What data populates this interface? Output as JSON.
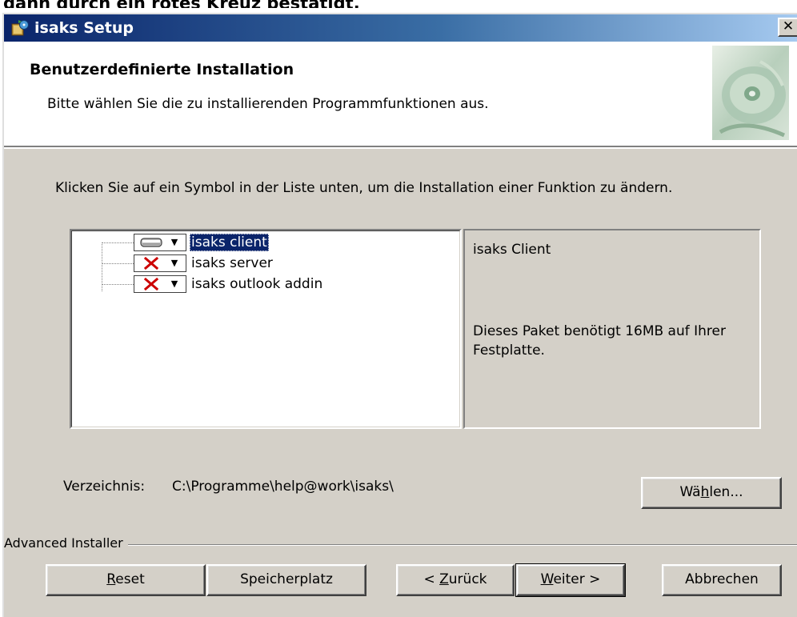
{
  "top_caption": "dann durch ein rotes Kreuz bestätigt.",
  "window": {
    "title": "isaks Setup",
    "close_symbol": "✕",
    "icon": "setup-package-icon"
  },
  "header": {
    "title": "Benutzerdefinierte Installation",
    "subtitle": "Bitte wählen Sie die zu installierenden Programmfunktionen aus.",
    "graphic": "cd-disc-graphic"
  },
  "instruction": "Klicken Sie auf ein Symbol in der Liste unten, um die Installation einer Funktion zu ändern.",
  "features": [
    {
      "label": "isaks client",
      "state": "install-local",
      "icon": "hard-drive-icon",
      "selected": true
    },
    {
      "label": "isaks server",
      "state": "not-installed",
      "icon": "red-x-icon",
      "selected": false
    },
    {
      "label": "isaks outlook addin",
      "state": "not-installed",
      "icon": "red-x-icon",
      "selected": false
    }
  ],
  "info": {
    "name": "isaks Client",
    "description": "Dieses Paket benötigt 16MB auf Ihrer Festplatte."
  },
  "directory": {
    "label": "Verzeichnis:",
    "value": "C:\\Programme\\help@work\\isaks\\"
  },
  "buttons": {
    "browse": {
      "pre": "Wä",
      "key": "h",
      "post": "len..."
    },
    "reset": {
      "pre": "",
      "key": "R",
      "post": "eset"
    },
    "disk_cost": "Speicherplatz",
    "back": {
      "pre": "< ",
      "key": "Z",
      "post": "urück"
    },
    "next": {
      "pre": "",
      "key": "W",
      "post": "eiter >"
    },
    "cancel": "Abbrechen"
  },
  "brand": "Advanced Installer",
  "colors": {
    "title_gradient_start": "#0a246a",
    "title_gradient_end": "#a6caf0",
    "dialog_bg": "#d4d0c8",
    "selection": "#0a246a",
    "red_x": "#cc0000"
  }
}
